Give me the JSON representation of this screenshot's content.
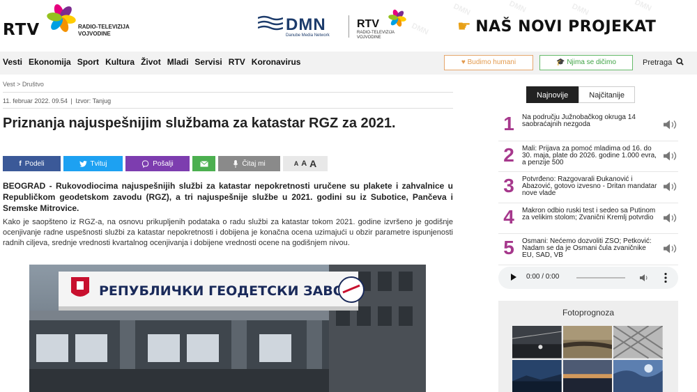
{
  "header": {
    "logo_main": "RTV",
    "logo_sub_1": "RADIO-TELEVIZIJA",
    "logo_sub_2": "VOJVODINE",
    "dmn_text": "DMN",
    "dmn_sub": "Danube Media Network",
    "rtv2_text": "RTV",
    "rtv2_sub_1": "RADIO-TELEVIZIJA",
    "rtv2_sub_2": "VOJVODINE",
    "promo_text": "NAŠ NOVI PROJEKAT",
    "watermark": "DMN"
  },
  "nav": {
    "items": [
      "Vesti",
      "Ekonomija",
      "Sport",
      "Kultura",
      "Život",
      "Mladi",
      "Servisi",
      "RTV",
      "Koronavirus"
    ],
    "humani_label": "Budimo humani",
    "dicimo_label": "Njima se dičimo",
    "search_label": "Pretraga"
  },
  "article": {
    "breadcrumb_1": "Vest",
    "breadcrumb_sep": ">",
    "breadcrumb_2": "Društvo",
    "date": "11. februar 2022. 09.54",
    "source": "Izvor: Tanjug",
    "title": "Priznanja najuspešnijim službama za katastar RGZ za 2021.",
    "lead": "BEOGRAD - Rukovodiocima najuspešnijih službi za katastar nepokretnosti uručene su plakete i zahvalnice u Republičkom geodetskom zavodu (RGZ), a tri najuspešnije službe u 2021. godini su iz Subotice, Pančeva i Sremske Mitrovice.",
    "body": "Kako je saopšteno iz RGZ-a, na osnovu prikupljenih podataka o radu službi za katastar tokom 2021. godine izvršeno je godišnje ocenjivanje radne uspešnosti službi za katastar nepokretnosti i dobijena je konačna ocena uzimajući u obzir parametre ispunjenosti radnih ciljeva, srednje vrednosti kvartalnog ocenjivanja i dobijene vrednosti ocene na godišnjem nivou.",
    "photo_sign": "РЕПУБЛИЧКИ ГЕОДЕТСКИ ЗАВОД"
  },
  "share": {
    "facebook": "Podeli",
    "twitter": "Tvituj",
    "viber": "Pošalji",
    "citaj": "Čitaj mi",
    "font_small": "A",
    "font_mid": "A",
    "font_large": "A"
  },
  "sidebar": {
    "tab_newest": "Najnovije",
    "tab_most_read": "Najčitanije",
    "items": [
      {
        "num": "1",
        "text": "Na području Južnobačkog okruga 14 saobraćajnih nezgoda"
      },
      {
        "num": "2",
        "text": "Mali: Prijava za pomoć mladima od 16. do 30. maja, plate do 2026. godine 1.000 evra, a penzije 500"
      },
      {
        "num": "3",
        "text": "Potvrđeno: Razgovarali Đukanović i Abazović, gotovo izvesno - Dritan mandatar nove vlade"
      },
      {
        "num": "4",
        "text": "Makron odbio ruski test i sedeo sa Putinom za velikim stolom; Zvanični Kremlj potvrdio"
      },
      {
        "num": "5",
        "text": "Osmani: Nećemo dozvoliti ZSO; Petković: Nadam se da je Osmani čula zvaničnike EU, SAD, VB"
      }
    ],
    "audio_time": "0:00 / 0:00",
    "foto_title": "Fotoprognoza"
  },
  "colors": {
    "accent_purple": "#a6388c",
    "facebook": "#3b5998",
    "twitter": "#1da1f2",
    "viber": "#7d3daf",
    "email": "#4caf50",
    "humani": "#e29a4e",
    "dicimo": "#3fa345"
  },
  "icons": {
    "heart": "heart-icon",
    "graduation": "graduation-cap-icon",
    "search": "search-icon",
    "speaker": "speaker-icon"
  }
}
